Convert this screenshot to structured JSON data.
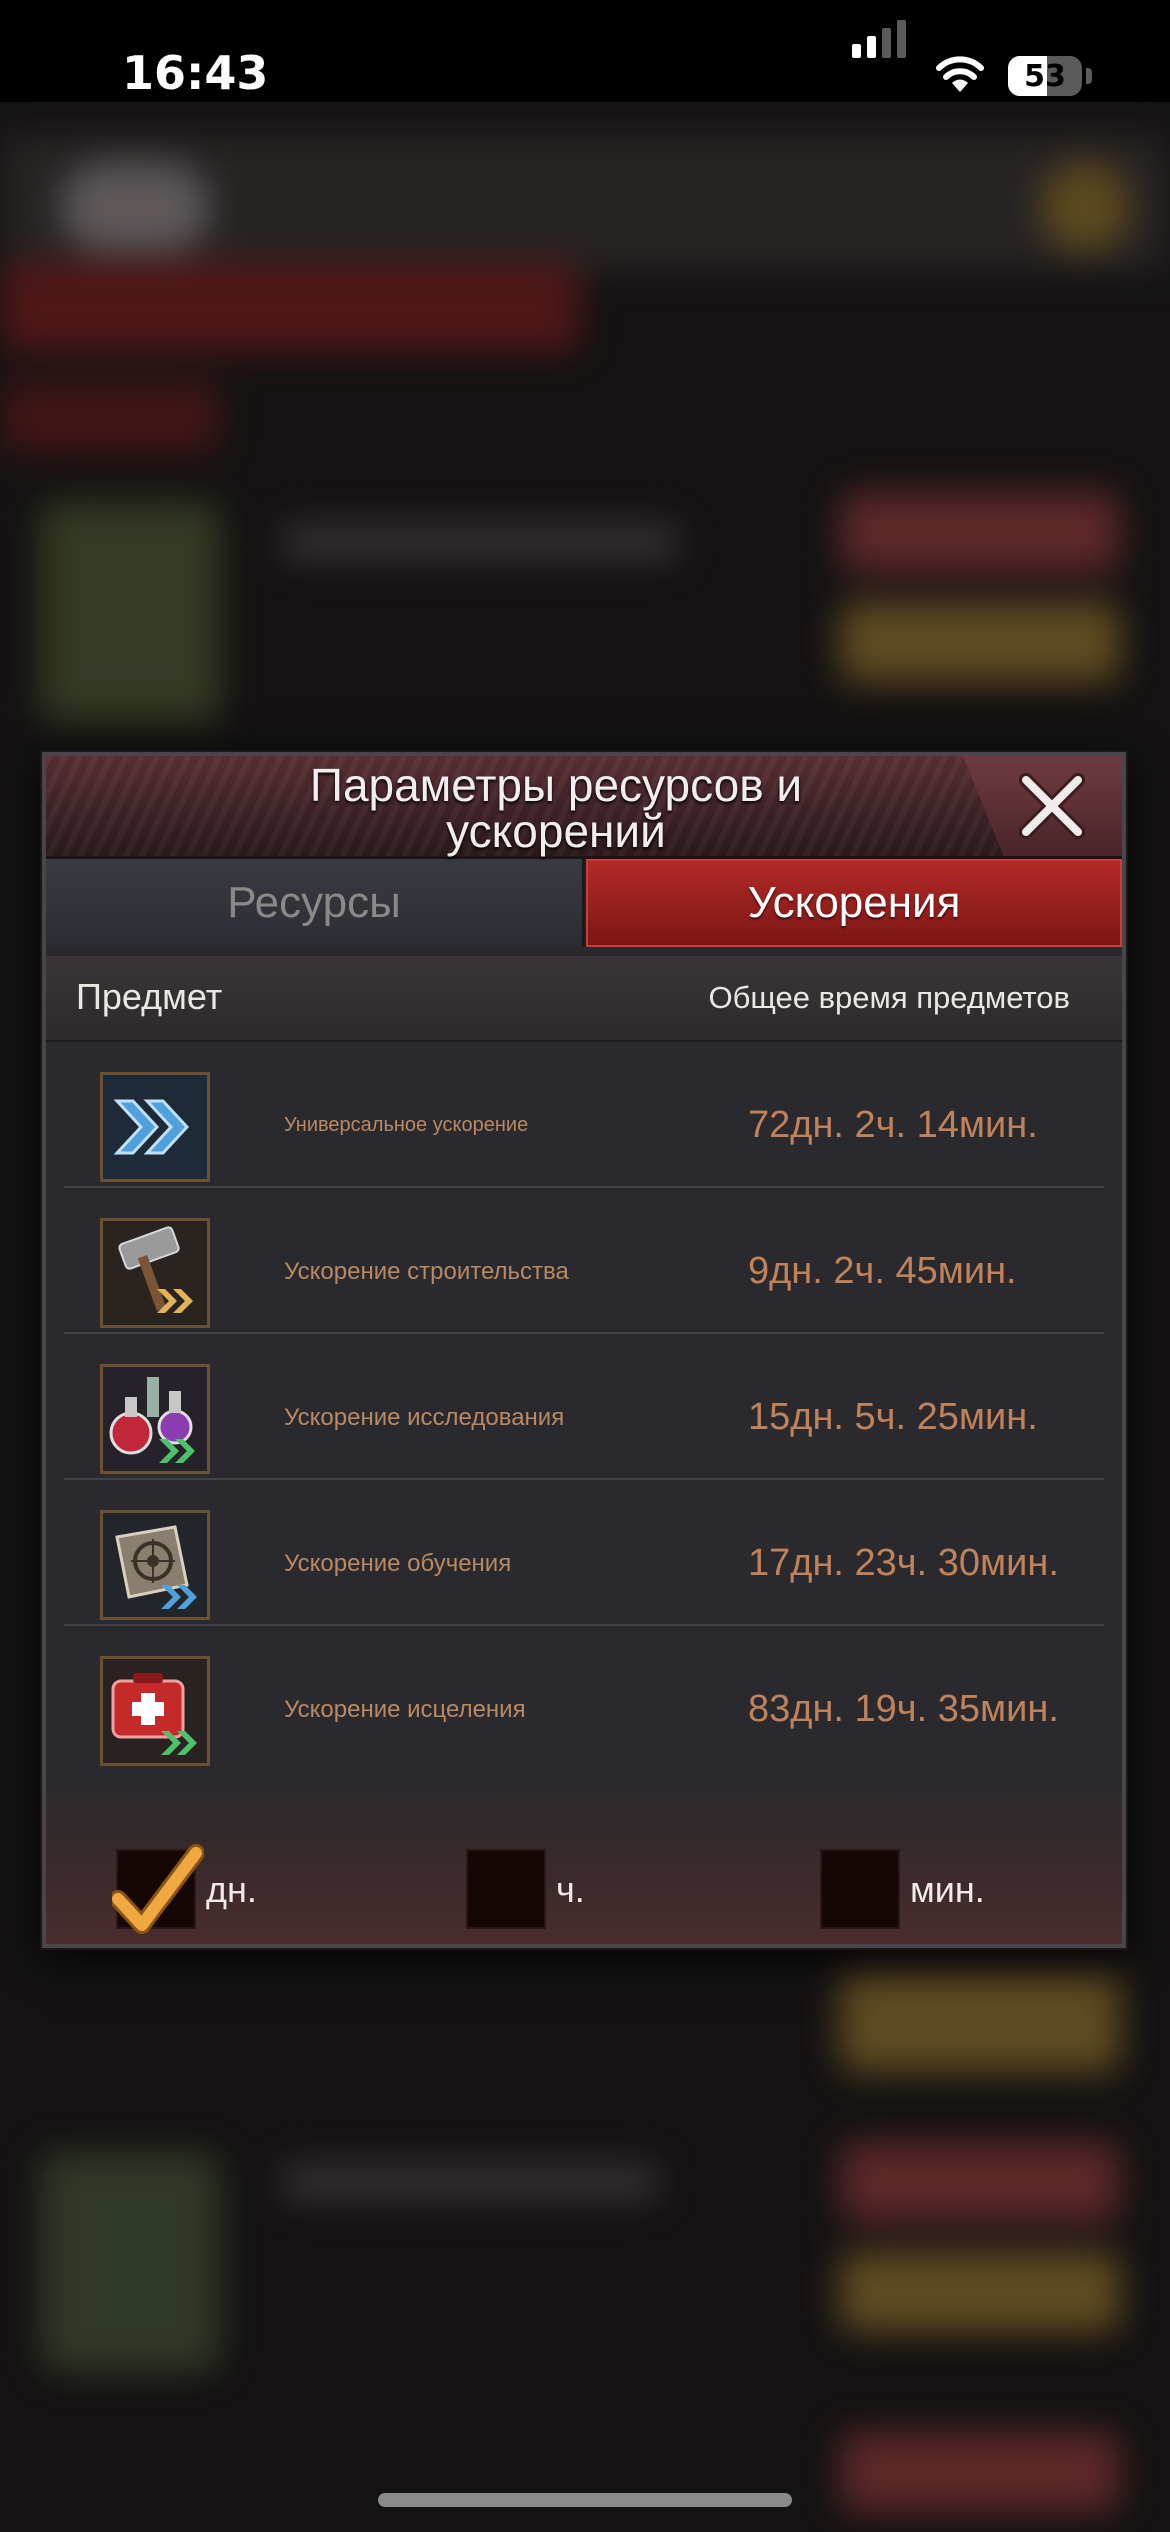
{
  "status_bar": {
    "time": "16:43",
    "battery": "53",
    "battery_level": 0.53,
    "icons": [
      "signal-icon",
      "wifi-icon",
      "battery-icon"
    ]
  },
  "modal": {
    "title": "Параметры ресурсов и ускорений",
    "close_icon": "close-icon",
    "tabs": [
      {
        "label": "Ресурсы",
        "active": false
      },
      {
        "label": "Ускорения",
        "active": true
      }
    ],
    "columns": {
      "item": "Предмет",
      "total_time": "Общее время предметов"
    },
    "items": [
      {
        "icon": "universal-speedup-icon",
        "name": "Универсальное ускорение",
        "time": "72дн. 2ч. 14мин."
      },
      {
        "icon": "construction-speedup-icon",
        "name": "Ускорение строительства",
        "time": "9дн. 2ч. 45мин."
      },
      {
        "icon": "research-speedup-icon",
        "name": "Ускорение исследования",
        "time": "15дн. 5ч. 25мин."
      },
      {
        "icon": "training-speedup-icon",
        "name": "Ускорение обучения",
        "time": "17дн. 23ч. 30мин."
      },
      {
        "icon": "healing-speedup-icon",
        "name": "Ускорение исцеления",
        "time": "83дн. 19ч. 35мин."
      }
    ],
    "units": [
      {
        "label": "дн.",
        "checked": true
      },
      {
        "label": "ч.",
        "checked": false
      },
      {
        "label": "мин.",
        "checked": false
      }
    ]
  },
  "colors": {
    "accent_red": "#b22a27",
    "time_text": "#c0825a",
    "check_orange": "#f0a840"
  }
}
